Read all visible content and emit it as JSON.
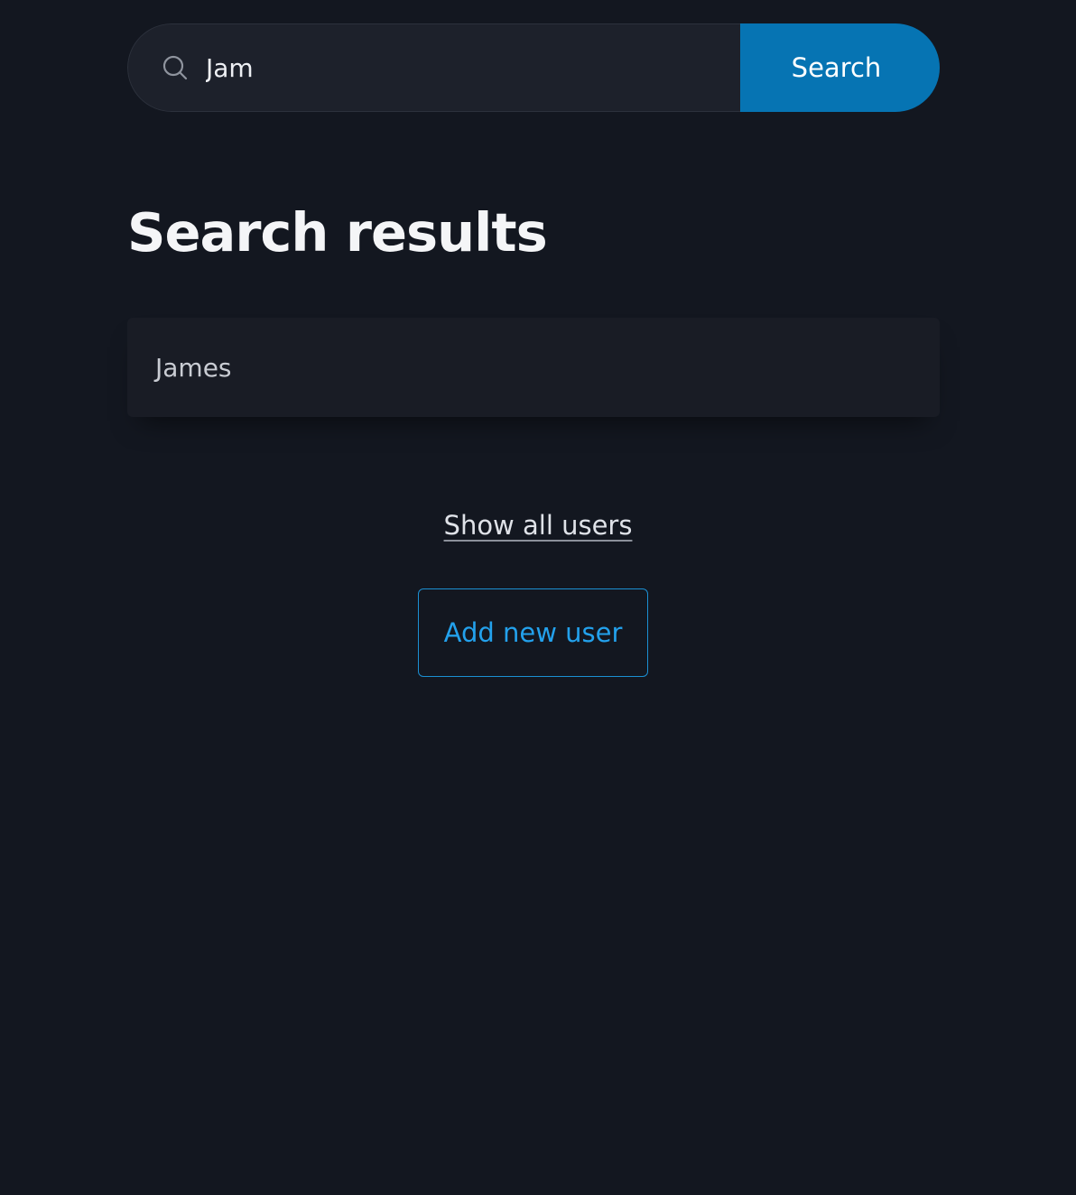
{
  "search": {
    "value": "Jam",
    "placeholder": "",
    "button_label": "Search",
    "icon": "search-icon"
  },
  "results": {
    "title": "Search results",
    "items": [
      {
        "label": "James"
      }
    ]
  },
  "actions": {
    "show_all_label": "Show all users",
    "add_user_label": "Add new user"
  },
  "colors": {
    "background": "#131720",
    "accent": "#0674b3",
    "link_accent": "#23a1ec"
  }
}
